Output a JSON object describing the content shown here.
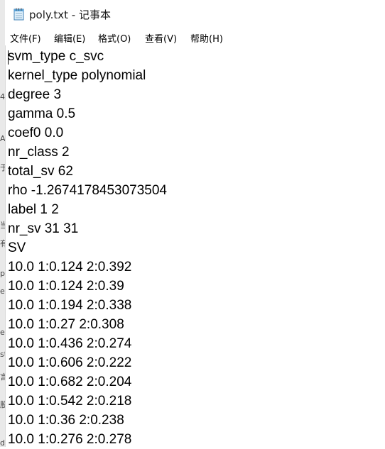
{
  "window": {
    "title": "poly.txt - 记事本"
  },
  "menu": [
    {
      "label": "文件(F)"
    },
    {
      "label": "编辑(E)"
    },
    {
      "label": "格式(O)"
    },
    {
      "label": "查看(V)"
    },
    {
      "label": "帮助(H)"
    }
  ],
  "lines": [
    "svm_type c_svc",
    "kernel_type polynomial",
    "degree 3",
    "gamma 0.5",
    "coef0 0.0",
    "nr_class 2",
    "total_sv 62",
    "rho -1.2674178453073504",
    "label 1 2",
    "nr_sv 31 31",
    "SV",
    "10.0 1:0.124 2:0.392",
    "10.0 1:0.124 2:0.39",
    "10.0 1:0.194 2:0.338",
    "10.0 1:0.27 2:0.308",
    "10.0 1:0.436 2:0.274",
    "10.0 1:0.606 2:0.222",
    "10.0 1:0.682 2:0.204",
    "10.0 1:0.542 2:0.218",
    "10.0 1:0.36 2:0.238",
    "10.0 1:0.276 2:0.278"
  ]
}
